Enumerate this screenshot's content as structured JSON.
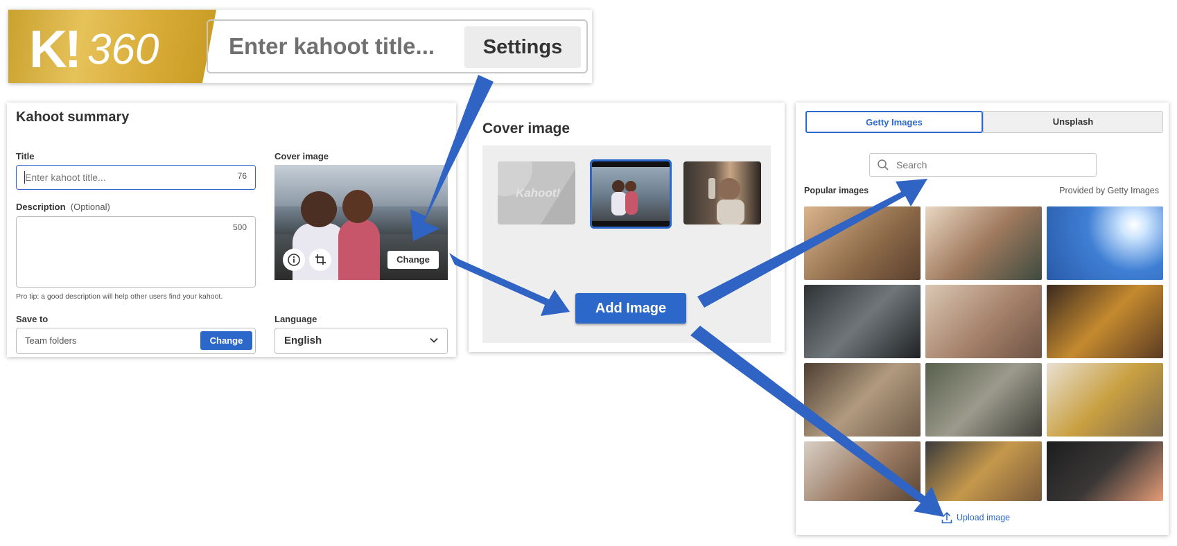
{
  "topbar": {
    "logo_text": "K!360",
    "title_placeholder": "Enter kahoot title...",
    "settings_label": "Settings"
  },
  "summary": {
    "heading": "Kahoot summary",
    "title_label": "Title",
    "title_placeholder": "Enter kahoot title...",
    "title_counter": "76",
    "description_label": "Description",
    "description_optional": "(Optional)",
    "description_counter": "500",
    "pro_tip": "Pro tip: a good description will help other users find your kahoot.",
    "save_to_label": "Save to",
    "save_to_value": "Team folders",
    "save_to_change": "Change",
    "cover_label": "Cover image",
    "cover_change": "Change",
    "language_label": "Language",
    "language_value": "English"
  },
  "cover_panel": {
    "heading": "Cover image",
    "default_thumb_text": "Kahoot!",
    "add_image_label": "Add Image"
  },
  "picker": {
    "tabs": [
      {
        "label": "Getty Images",
        "active": true
      },
      {
        "label": "Unsplash",
        "active": false
      }
    ],
    "search_placeholder": "Search",
    "popular_label": "Popular images",
    "provided_by": "Provided by Getty Images",
    "upload_label": "Upload image"
  },
  "colors": {
    "accent": "#2c68c9",
    "gold": "#d7aa35",
    "arrow": "#2f63c4"
  }
}
